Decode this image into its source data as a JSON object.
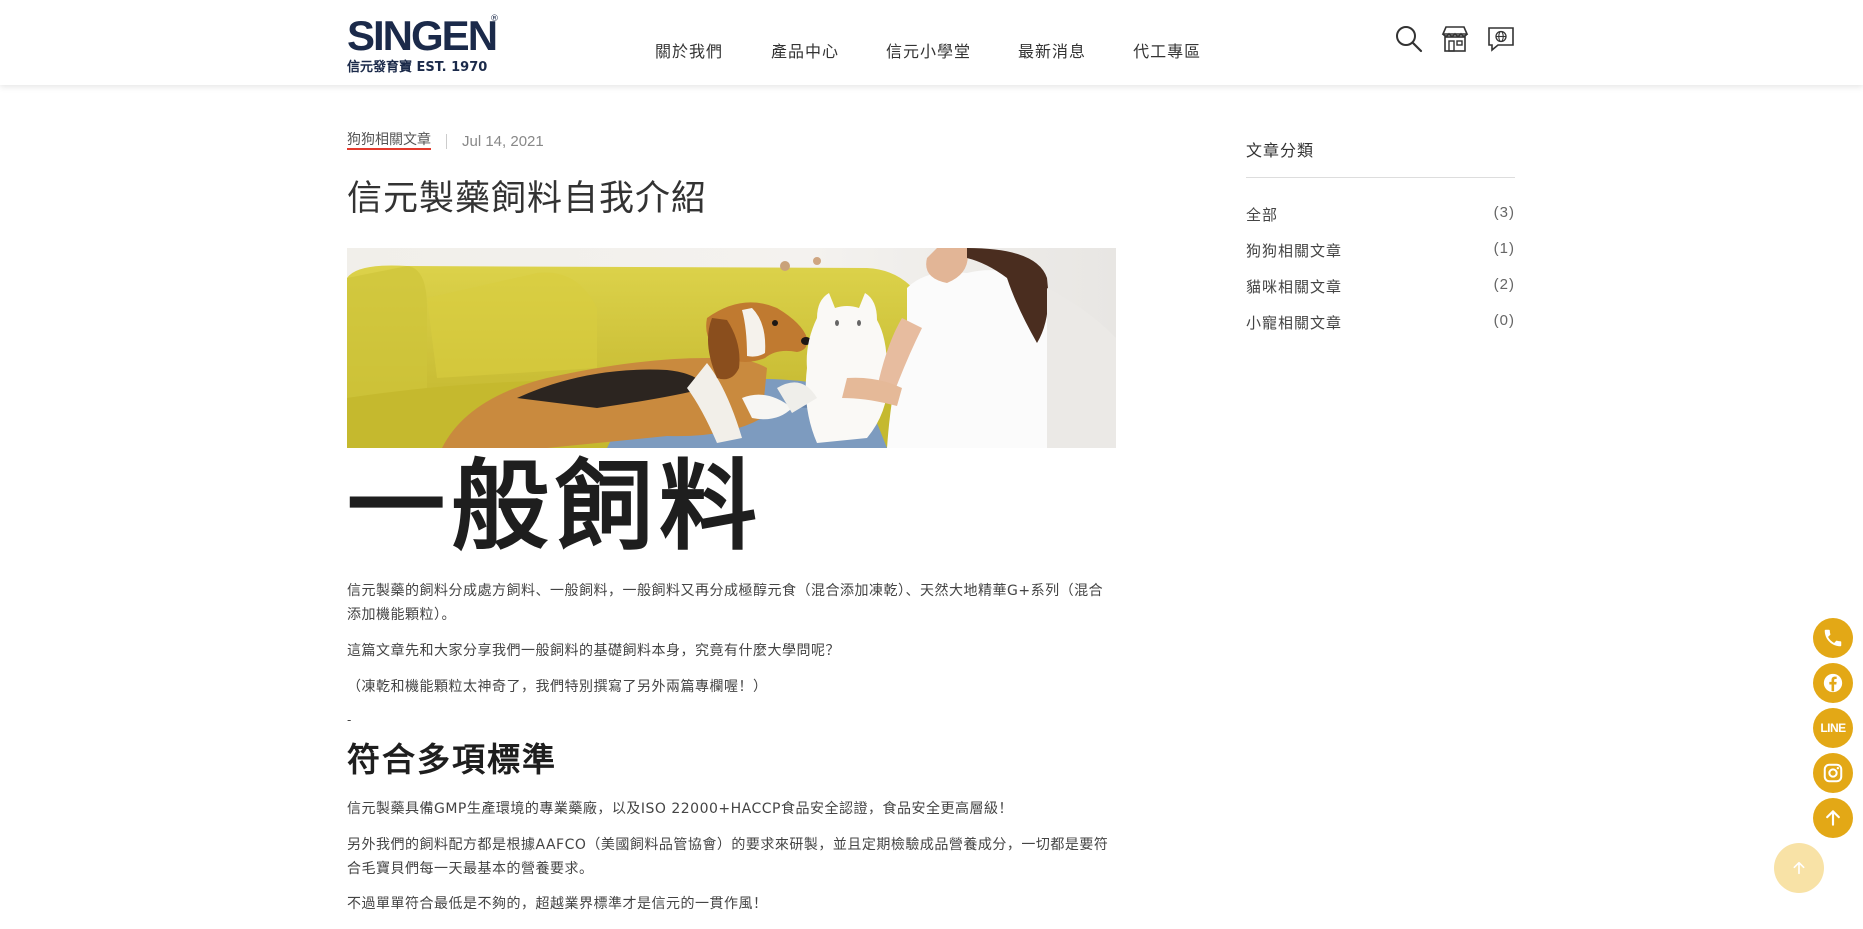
{
  "header": {
    "logo_main": "SINGEN",
    "logo_reg": "®",
    "logo_sub": "信元發育寶  EST. 1970",
    "nav": [
      "關於我們",
      "產品中心",
      "信元小學堂",
      "最新消息",
      "代工專區"
    ],
    "icons": [
      "search-icon",
      "store-icon",
      "chat-icon"
    ]
  },
  "post": {
    "category": "狗狗相關文章",
    "date": "Jul 14, 2021",
    "title": "信元製藥飼料自我介紹",
    "hero_alt": "beagle-and-cat-on-sofa",
    "big_heading": "一般飼料",
    "p1": "信元製藥的飼料分成處方飼料、一般飼料，一般飼料又再分成極醇元食（混合添加凍乾）、天然大地精華G+系列（混合添加機能顆粒）。",
    "p2": "這篇文章先和大家分享我們一般飼料的基礎飼料本身，究竟有什麼大學問呢？",
    "p3": "（凍乾和機能顆粒太神奇了，我們特別撰寫了另外兩篇專欄喔！）",
    "dash": "-",
    "sub_heading": "符合多項標準",
    "p4": "信元製藥具備GMP生產環境的專業藥廠，以及ISO 22000+HACCP食品安全認證，食品安全更高層級！",
    "p5": "另外我們的飼料配方都是根據AAFCO（美國飼料品管協會）的要求來研製，並且定期檢驗成品營養成分，一切都是要符合毛寶貝們每一天最基本的營養要求。",
    "p6": "不過單單符合最低是不夠的，超越業界標準才是信元的一貫作風！"
  },
  "sidebar": {
    "title": "文章分類",
    "items": [
      {
        "label": "全部",
        "count": "(3)"
      },
      {
        "label": "狗狗相關文章",
        "count": "(1)"
      },
      {
        "label": "貓咪相關文章",
        "count": "(2)"
      },
      {
        "label": "小寵相關文章",
        "count": "(0)"
      }
    ]
  },
  "floating": {
    "line_label": "LINE",
    "buttons": [
      "phone-icon",
      "facebook-icon",
      "line-icon",
      "instagram-icon",
      "arrow-up-icon"
    ]
  },
  "colors": {
    "accent": "#e3a816",
    "category_underline": "#e33a2d",
    "logo": "#1b2a4a"
  }
}
